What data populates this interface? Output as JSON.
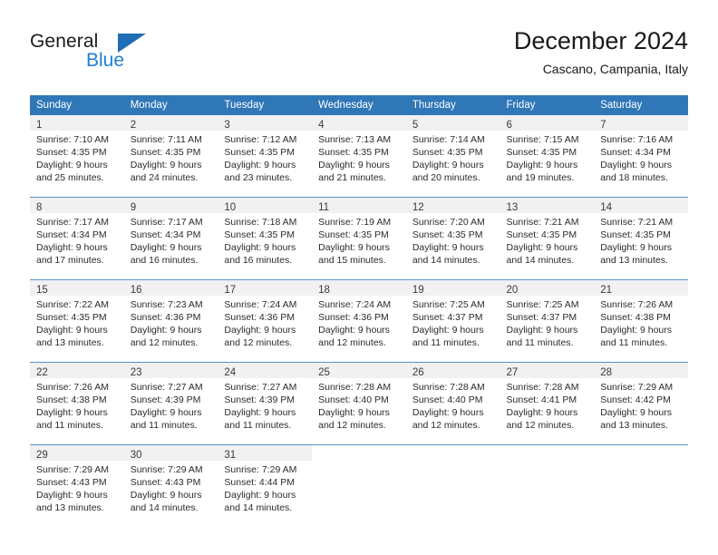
{
  "logo": {
    "word_top": "General",
    "word_bottom": "Blue",
    "triangle_color": "#1f6db5",
    "blue_color": "#1f7fd0"
  },
  "header": {
    "title": "December 2024",
    "subtitle": "Cascano, Campania, Italy"
  },
  "theme": {
    "header_bg": "#3077b8",
    "header_text": "#ffffff",
    "daynum_band_bg": "#f1f1f1",
    "row_divider": "#5b93c9"
  },
  "weekday_headers": [
    "Sunday",
    "Monday",
    "Tuesday",
    "Wednesday",
    "Thursday",
    "Friday",
    "Saturday"
  ],
  "weeks": [
    [
      {
        "day": "1",
        "sunrise": "Sunrise: 7:10 AM",
        "sunset": "Sunset: 4:35 PM",
        "daylight_1": "Daylight: 9 hours",
        "daylight_2": "and 25 minutes."
      },
      {
        "day": "2",
        "sunrise": "Sunrise: 7:11 AM",
        "sunset": "Sunset: 4:35 PM",
        "daylight_1": "Daylight: 9 hours",
        "daylight_2": "and 24 minutes."
      },
      {
        "day": "3",
        "sunrise": "Sunrise: 7:12 AM",
        "sunset": "Sunset: 4:35 PM",
        "daylight_1": "Daylight: 9 hours",
        "daylight_2": "and 23 minutes."
      },
      {
        "day": "4",
        "sunrise": "Sunrise: 7:13 AM",
        "sunset": "Sunset: 4:35 PM",
        "daylight_1": "Daylight: 9 hours",
        "daylight_2": "and 21 minutes."
      },
      {
        "day": "5",
        "sunrise": "Sunrise: 7:14 AM",
        "sunset": "Sunset: 4:35 PM",
        "daylight_1": "Daylight: 9 hours",
        "daylight_2": "and 20 minutes."
      },
      {
        "day": "6",
        "sunrise": "Sunrise: 7:15 AM",
        "sunset": "Sunset: 4:35 PM",
        "daylight_1": "Daylight: 9 hours",
        "daylight_2": "and 19 minutes."
      },
      {
        "day": "7",
        "sunrise": "Sunrise: 7:16 AM",
        "sunset": "Sunset: 4:34 PM",
        "daylight_1": "Daylight: 9 hours",
        "daylight_2": "and 18 minutes."
      }
    ],
    [
      {
        "day": "8",
        "sunrise": "Sunrise: 7:17 AM",
        "sunset": "Sunset: 4:34 PM",
        "daylight_1": "Daylight: 9 hours",
        "daylight_2": "and 17 minutes."
      },
      {
        "day": "9",
        "sunrise": "Sunrise: 7:17 AM",
        "sunset": "Sunset: 4:34 PM",
        "daylight_1": "Daylight: 9 hours",
        "daylight_2": "and 16 minutes."
      },
      {
        "day": "10",
        "sunrise": "Sunrise: 7:18 AM",
        "sunset": "Sunset: 4:35 PM",
        "daylight_1": "Daylight: 9 hours",
        "daylight_2": "and 16 minutes."
      },
      {
        "day": "11",
        "sunrise": "Sunrise: 7:19 AM",
        "sunset": "Sunset: 4:35 PM",
        "daylight_1": "Daylight: 9 hours",
        "daylight_2": "and 15 minutes."
      },
      {
        "day": "12",
        "sunrise": "Sunrise: 7:20 AM",
        "sunset": "Sunset: 4:35 PM",
        "daylight_1": "Daylight: 9 hours",
        "daylight_2": "and 14 minutes."
      },
      {
        "day": "13",
        "sunrise": "Sunrise: 7:21 AM",
        "sunset": "Sunset: 4:35 PM",
        "daylight_1": "Daylight: 9 hours",
        "daylight_2": "and 14 minutes."
      },
      {
        "day": "14",
        "sunrise": "Sunrise: 7:21 AM",
        "sunset": "Sunset: 4:35 PM",
        "daylight_1": "Daylight: 9 hours",
        "daylight_2": "and 13 minutes."
      }
    ],
    [
      {
        "day": "15",
        "sunrise": "Sunrise: 7:22 AM",
        "sunset": "Sunset: 4:35 PM",
        "daylight_1": "Daylight: 9 hours",
        "daylight_2": "and 13 minutes."
      },
      {
        "day": "16",
        "sunrise": "Sunrise: 7:23 AM",
        "sunset": "Sunset: 4:36 PM",
        "daylight_1": "Daylight: 9 hours",
        "daylight_2": "and 12 minutes."
      },
      {
        "day": "17",
        "sunrise": "Sunrise: 7:24 AM",
        "sunset": "Sunset: 4:36 PM",
        "daylight_1": "Daylight: 9 hours",
        "daylight_2": "and 12 minutes."
      },
      {
        "day": "18",
        "sunrise": "Sunrise: 7:24 AM",
        "sunset": "Sunset: 4:36 PM",
        "daylight_1": "Daylight: 9 hours",
        "daylight_2": "and 12 minutes."
      },
      {
        "day": "19",
        "sunrise": "Sunrise: 7:25 AM",
        "sunset": "Sunset: 4:37 PM",
        "daylight_1": "Daylight: 9 hours",
        "daylight_2": "and 11 minutes."
      },
      {
        "day": "20",
        "sunrise": "Sunrise: 7:25 AM",
        "sunset": "Sunset: 4:37 PM",
        "daylight_1": "Daylight: 9 hours",
        "daylight_2": "and 11 minutes."
      },
      {
        "day": "21",
        "sunrise": "Sunrise: 7:26 AM",
        "sunset": "Sunset: 4:38 PM",
        "daylight_1": "Daylight: 9 hours",
        "daylight_2": "and 11 minutes."
      }
    ],
    [
      {
        "day": "22",
        "sunrise": "Sunrise: 7:26 AM",
        "sunset": "Sunset: 4:38 PM",
        "daylight_1": "Daylight: 9 hours",
        "daylight_2": "and 11 minutes."
      },
      {
        "day": "23",
        "sunrise": "Sunrise: 7:27 AM",
        "sunset": "Sunset: 4:39 PM",
        "daylight_1": "Daylight: 9 hours",
        "daylight_2": "and 11 minutes."
      },
      {
        "day": "24",
        "sunrise": "Sunrise: 7:27 AM",
        "sunset": "Sunset: 4:39 PM",
        "daylight_1": "Daylight: 9 hours",
        "daylight_2": "and 11 minutes."
      },
      {
        "day": "25",
        "sunrise": "Sunrise: 7:28 AM",
        "sunset": "Sunset: 4:40 PM",
        "daylight_1": "Daylight: 9 hours",
        "daylight_2": "and 12 minutes."
      },
      {
        "day": "26",
        "sunrise": "Sunrise: 7:28 AM",
        "sunset": "Sunset: 4:40 PM",
        "daylight_1": "Daylight: 9 hours",
        "daylight_2": "and 12 minutes."
      },
      {
        "day": "27",
        "sunrise": "Sunrise: 7:28 AM",
        "sunset": "Sunset: 4:41 PM",
        "daylight_1": "Daylight: 9 hours",
        "daylight_2": "and 12 minutes."
      },
      {
        "day": "28",
        "sunrise": "Sunrise: 7:29 AM",
        "sunset": "Sunset: 4:42 PM",
        "daylight_1": "Daylight: 9 hours",
        "daylight_2": "and 13 minutes."
      }
    ],
    [
      {
        "day": "29",
        "sunrise": "Sunrise: 7:29 AM",
        "sunset": "Sunset: 4:43 PM",
        "daylight_1": "Daylight: 9 hours",
        "daylight_2": "and 13 minutes."
      },
      {
        "day": "30",
        "sunrise": "Sunrise: 7:29 AM",
        "sunset": "Sunset: 4:43 PM",
        "daylight_1": "Daylight: 9 hours",
        "daylight_2": "and 14 minutes."
      },
      {
        "day": "31",
        "sunrise": "Sunrise: 7:29 AM",
        "sunset": "Sunset: 4:44 PM",
        "daylight_1": "Daylight: 9 hours",
        "daylight_2": "and 14 minutes."
      },
      null,
      null,
      null,
      null
    ]
  ]
}
